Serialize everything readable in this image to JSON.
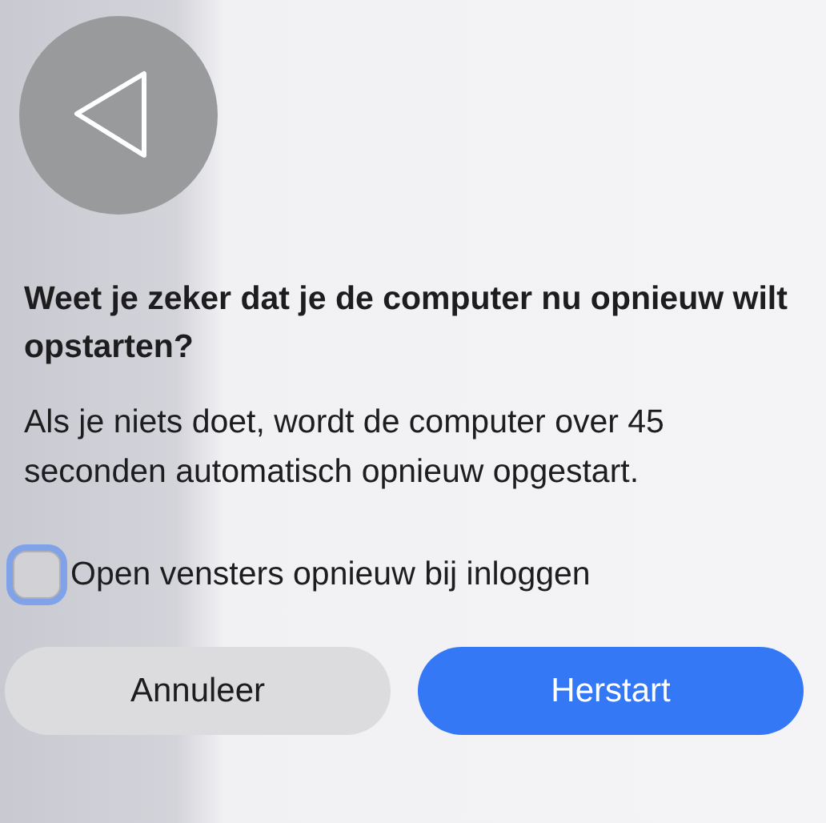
{
  "dialog": {
    "title": "Weet je zeker dat je de computer nu opnieuw wilt opstarten?",
    "message": "Als je niets doet, wordt de computer over 45 seconden automatisch opnieuw opgestart.",
    "checkbox": {
      "label": "Open vensters opnieuw bij inloggen",
      "checked": false,
      "focused": true
    },
    "buttons": [
      {
        "label": "Annuleer",
        "kind": "secondary"
      },
      {
        "label": "Herstart",
        "kind": "primary"
      }
    ]
  }
}
